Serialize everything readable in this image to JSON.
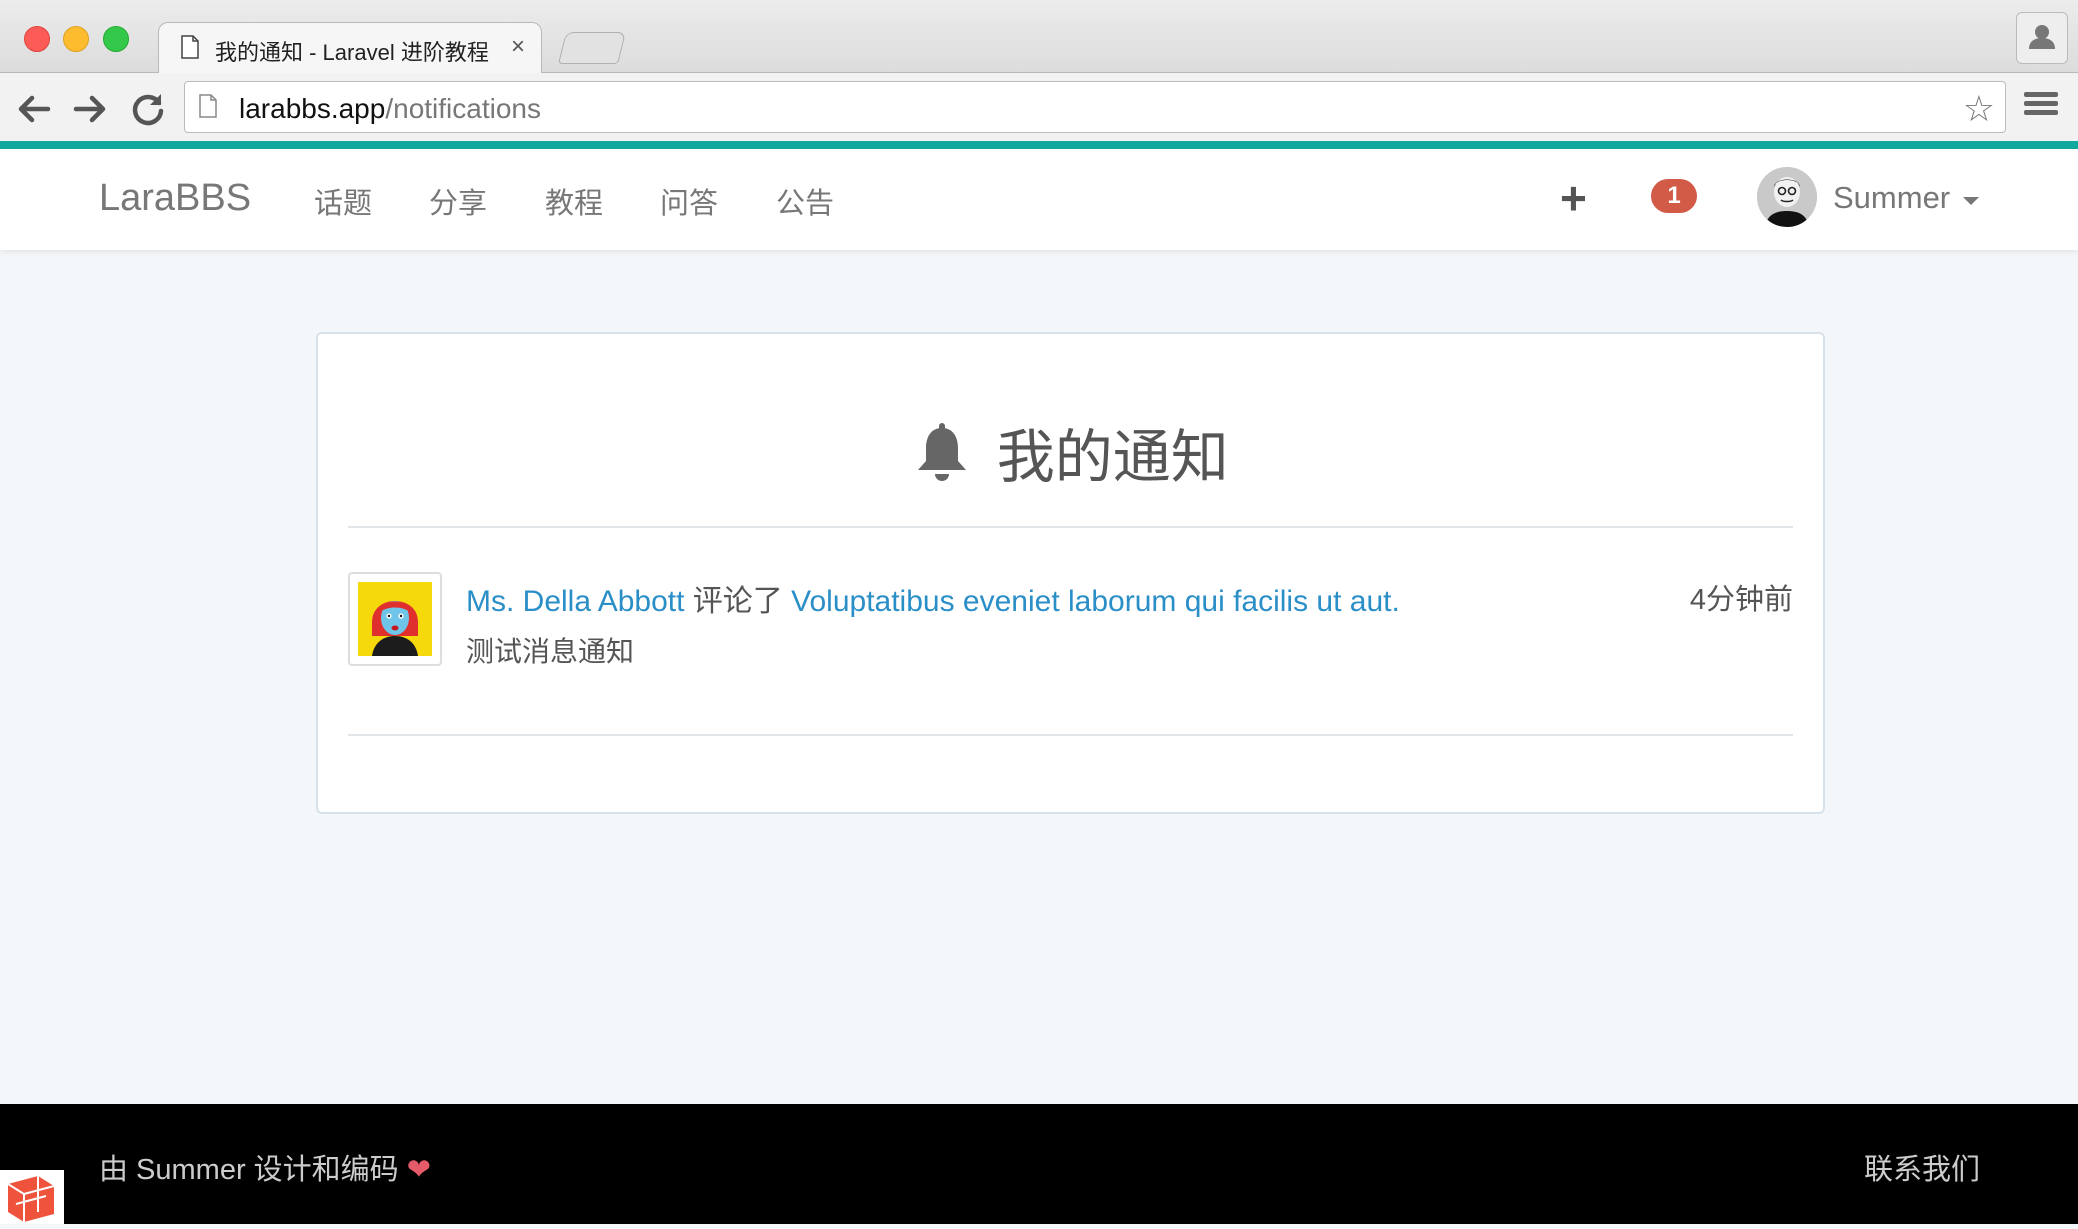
{
  "browser": {
    "tab_title": "我的通知 - Laravel 进阶教程",
    "tab_close": "×",
    "url_host": "larabbs.app",
    "url_path": "/notifications",
    "star": "☆"
  },
  "navbar": {
    "brand": "LaraBBS",
    "items": [
      {
        "label": "话题"
      },
      {
        "label": "分享"
      },
      {
        "label": "教程"
      },
      {
        "label": "问答"
      },
      {
        "label": "公告"
      }
    ],
    "create": "+",
    "notification_count": "1",
    "user_name": "Summer"
  },
  "page": {
    "title": "我的通知",
    "icon": "bell-icon"
  },
  "notifications": [
    {
      "user": "Ms. Della Abbott",
      "action": "评论了",
      "topic": "Voluptatibus eveniet laborum qui facilis ut aut.",
      "time": "4分钟前",
      "message": "测试消息通知"
    }
  ],
  "footer": {
    "credit": "由 Summer 设计和编码",
    "heart": "❤",
    "contact": "联系我们"
  },
  "colors": {
    "accent_bar": "#13a89e",
    "link": "#2a8ec7",
    "badge": "#d15b47",
    "footer_bg": "#000000",
    "page_bg": "#f4f7f9"
  }
}
